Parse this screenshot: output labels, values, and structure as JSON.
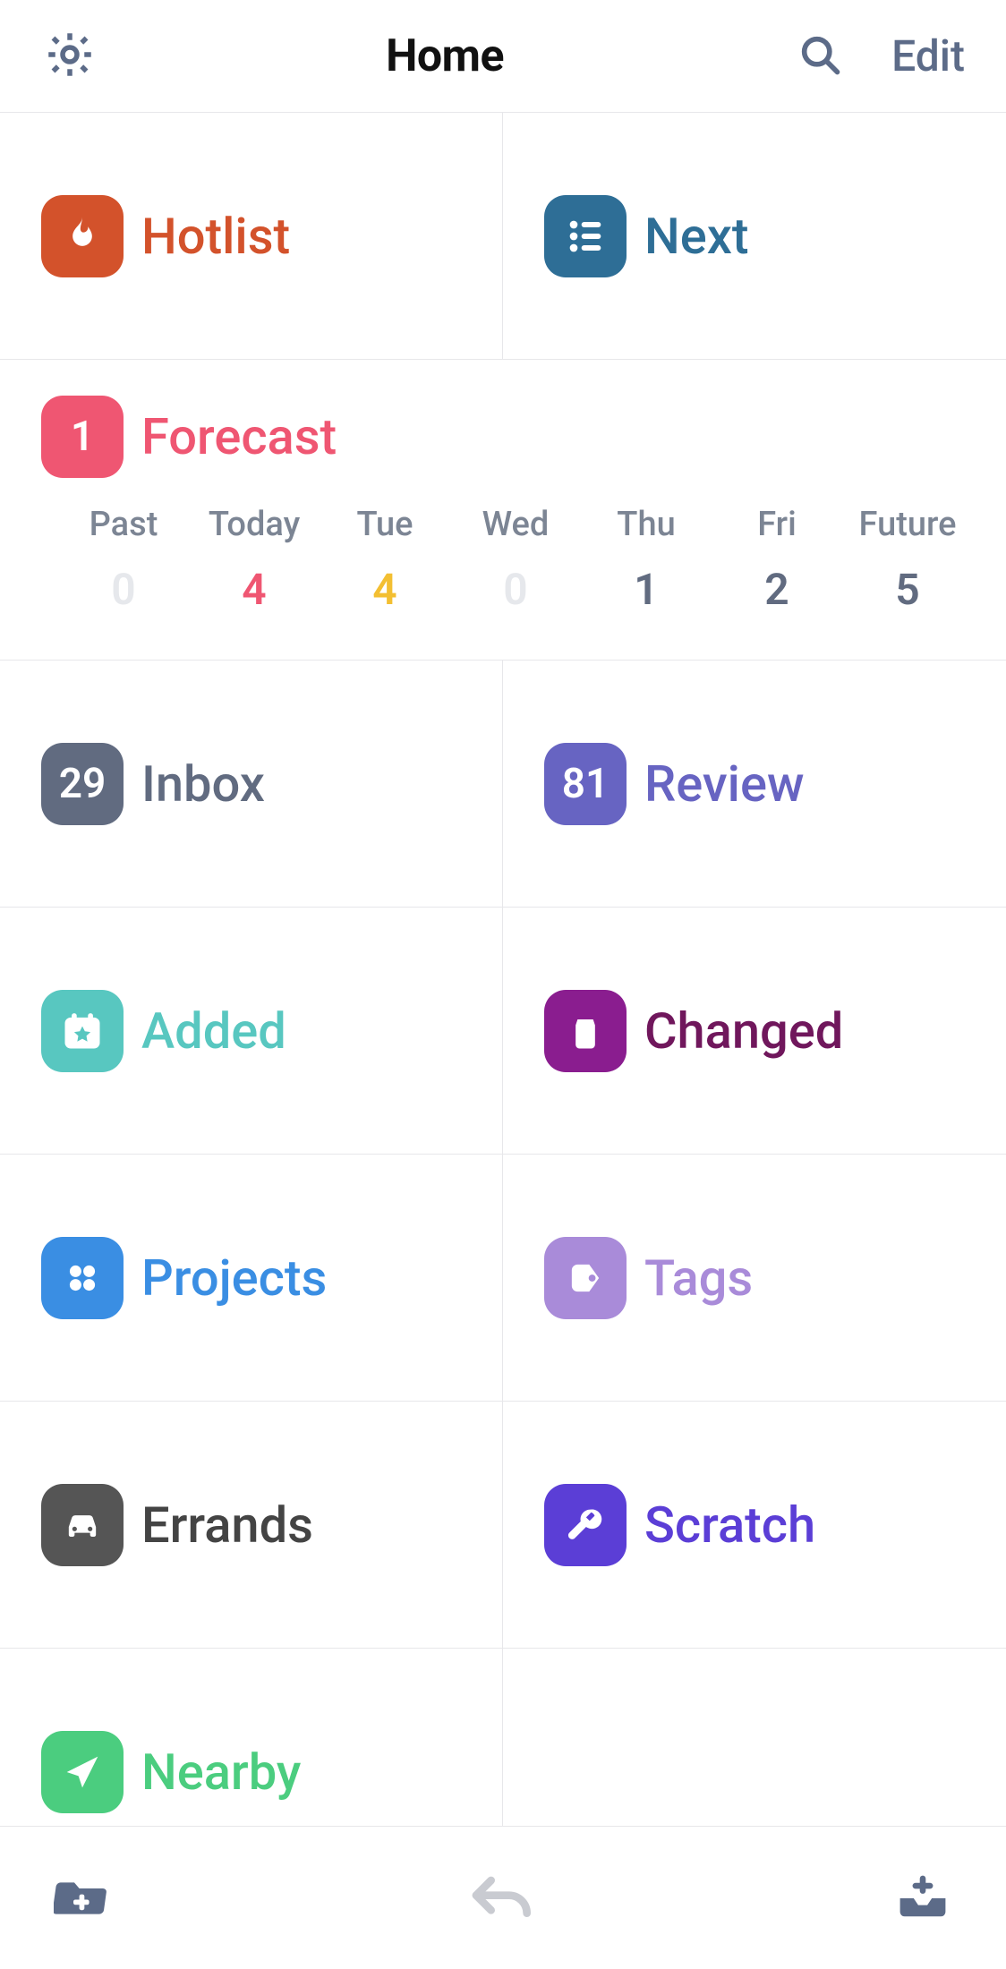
{
  "header": {
    "title": "Home",
    "edit_label": "Edit"
  },
  "tiles": {
    "hotlist": {
      "label": "Hotlist"
    },
    "next": {
      "label": "Next"
    },
    "forecast": {
      "label": "Forecast",
      "badge": "1"
    },
    "inbox": {
      "label": "Inbox",
      "badge": "29"
    },
    "review": {
      "label": "Review",
      "badge": "81"
    },
    "added": {
      "label": "Added"
    },
    "changed": {
      "label": "Changed"
    },
    "projects": {
      "label": "Projects"
    },
    "tags": {
      "label": "Tags"
    },
    "errands": {
      "label": "Errands"
    },
    "scratch": {
      "label": "Scratch"
    },
    "nearby": {
      "label": "Nearby"
    }
  },
  "forecast_days": {
    "past": {
      "name": "Past",
      "count": "0"
    },
    "today": {
      "name": "Today",
      "count": "4"
    },
    "tue": {
      "name": "Tue",
      "count": "4"
    },
    "wed": {
      "name": "Wed",
      "count": "0"
    },
    "thu": {
      "name": "Thu",
      "count": "1"
    },
    "fri": {
      "name": "Fri",
      "count": "2"
    },
    "future": {
      "name": "Future",
      "count": "5"
    }
  }
}
